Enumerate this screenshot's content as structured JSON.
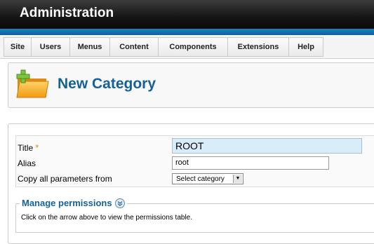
{
  "header": {
    "title": "Administration"
  },
  "menu": {
    "items": [
      {
        "label": "Site"
      },
      {
        "label": "Users"
      },
      {
        "label": "Menus"
      },
      {
        "label": "Content"
      },
      {
        "label": "Components"
      },
      {
        "label": "Extensions"
      },
      {
        "label": "Help"
      }
    ]
  },
  "toolbar": {
    "title": "New Category",
    "icon": "folder-add-icon"
  },
  "form": {
    "title_label": "Title",
    "required_marker": "*",
    "title_value": "ROOT",
    "alias_label": "Alias",
    "alias_value": "root",
    "copy_label": "Copy all parameters from",
    "copy_selected": "Select category"
  },
  "permissions": {
    "legend": "Manage permissions",
    "help": "Click on the arrow above to view the permissions table."
  },
  "colors": {
    "header_bg": "#151515",
    "accent_blue": "#146295",
    "stripe_blue": "#1d7fc0",
    "title_field_bg": "#d9ecfa",
    "required_orange": "#e29000"
  }
}
